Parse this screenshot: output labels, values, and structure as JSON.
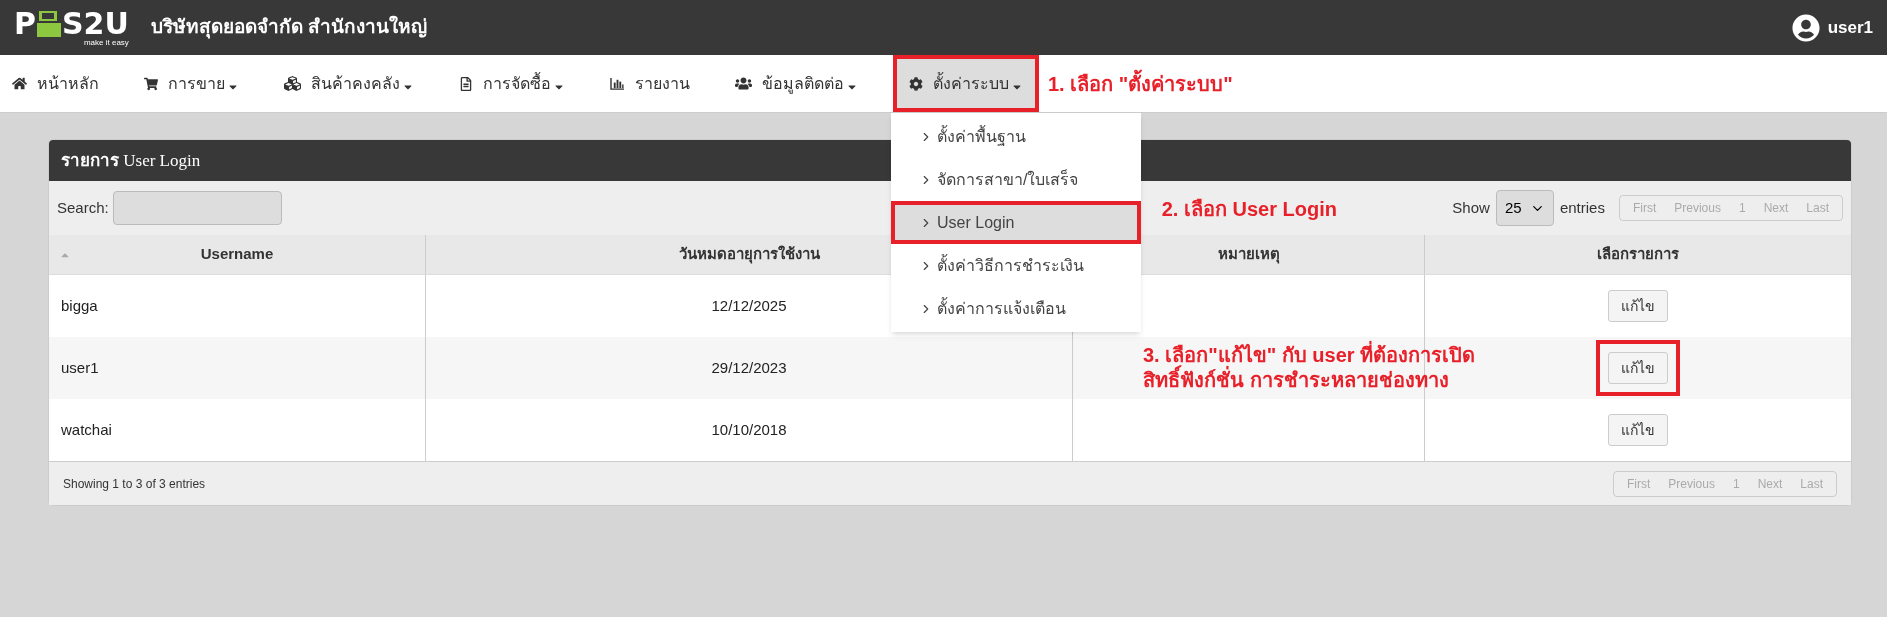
{
  "header": {
    "logo": {
      "left": "P",
      "right": "S2U",
      "tagline": "make it easy"
    },
    "company": "บริษัทสุดยอดจำกัด สำนักงานใหญ่",
    "user": "user1"
  },
  "nav": [
    {
      "label": "หน้าหลัก",
      "dropdown": false,
      "selected": false,
      "highlighted": false
    },
    {
      "label": "การขาย",
      "dropdown": true,
      "selected": false,
      "highlighted": false
    },
    {
      "label": "สินค้าคงคลัง",
      "dropdown": true,
      "selected": false,
      "highlighted": false
    },
    {
      "label": "การจัดซื้อ",
      "dropdown": true,
      "selected": false,
      "highlighted": false
    },
    {
      "label": "รายงาน",
      "dropdown": false,
      "selected": false,
      "highlighted": false
    },
    {
      "label": "ข้อมูลติดต่อ",
      "dropdown": true,
      "selected": false,
      "highlighted": false
    },
    {
      "label": "ตั้งค่าระบบ",
      "dropdown": true,
      "selected": true,
      "highlighted": true
    }
  ],
  "dropdown_menu": [
    {
      "label": "ตั้งค่าพื้นฐาน",
      "selected": false,
      "highlighted": false
    },
    {
      "label": "จัดการสาขา/ใบเสร็จ",
      "selected": false,
      "highlighted": false
    },
    {
      "label": "User Login",
      "selected": true,
      "highlighted": true
    },
    {
      "label": "ตั้งค่าวิธีการชำระเงิน",
      "selected": false,
      "highlighted": false
    },
    {
      "label": "ตั้งค่าการแจ้งเตือน",
      "selected": false,
      "highlighted": false
    }
  ],
  "panel": {
    "title_bold": "รายการ",
    "title": "User Login",
    "search_label": "Search:",
    "show_label": "Show",
    "page_size": "25",
    "entries_label": "entries",
    "pager": [
      {
        "label": "First"
      },
      {
        "label": "Previous"
      },
      {
        "label": "1"
      },
      {
        "label": "Next"
      },
      {
        "label": "Last"
      }
    ],
    "columns": [
      {
        "label": "Username",
        "sorted": true
      },
      {
        "label": "วันหมดอายุการใช้งาน"
      },
      {
        "label": "หมายเหตุ"
      },
      {
        "label": "เลือกรายการ"
      }
    ],
    "rows": [
      {
        "username": "bigga",
        "expiry": "12/12/2025",
        "action": "แก้ไข",
        "highlighted": false
      },
      {
        "username": "user1",
        "expiry": "29/12/2023",
        "action": "แก้ไข",
        "highlighted": true
      },
      {
        "username": "watchai",
        "expiry": "10/10/2018",
        "action": "แก้ไข",
        "highlighted": false
      }
    ],
    "info": "Showing 1 to 3 of 3 entries",
    "bottom_pager": [
      {
        "label": "First"
      },
      {
        "label": "Previous"
      },
      {
        "label": "1"
      },
      {
        "label": "Next"
      },
      {
        "label": "Last"
      }
    ]
  },
  "annotations": [
    {
      "lines": [
        "1. เลือก \"ตั้งค่าระบบ\""
      ]
    },
    {
      "lines": [
        "2. เลือก User Login"
      ]
    },
    {
      "lines": [
        "3. เลือก\"แก้ไข\" กับ user ที่ต้องการเปิด",
        "สิทธิ์ฟังก์ชั่น การชำระหลายช่องทาง"
      ]
    }
  ]
}
